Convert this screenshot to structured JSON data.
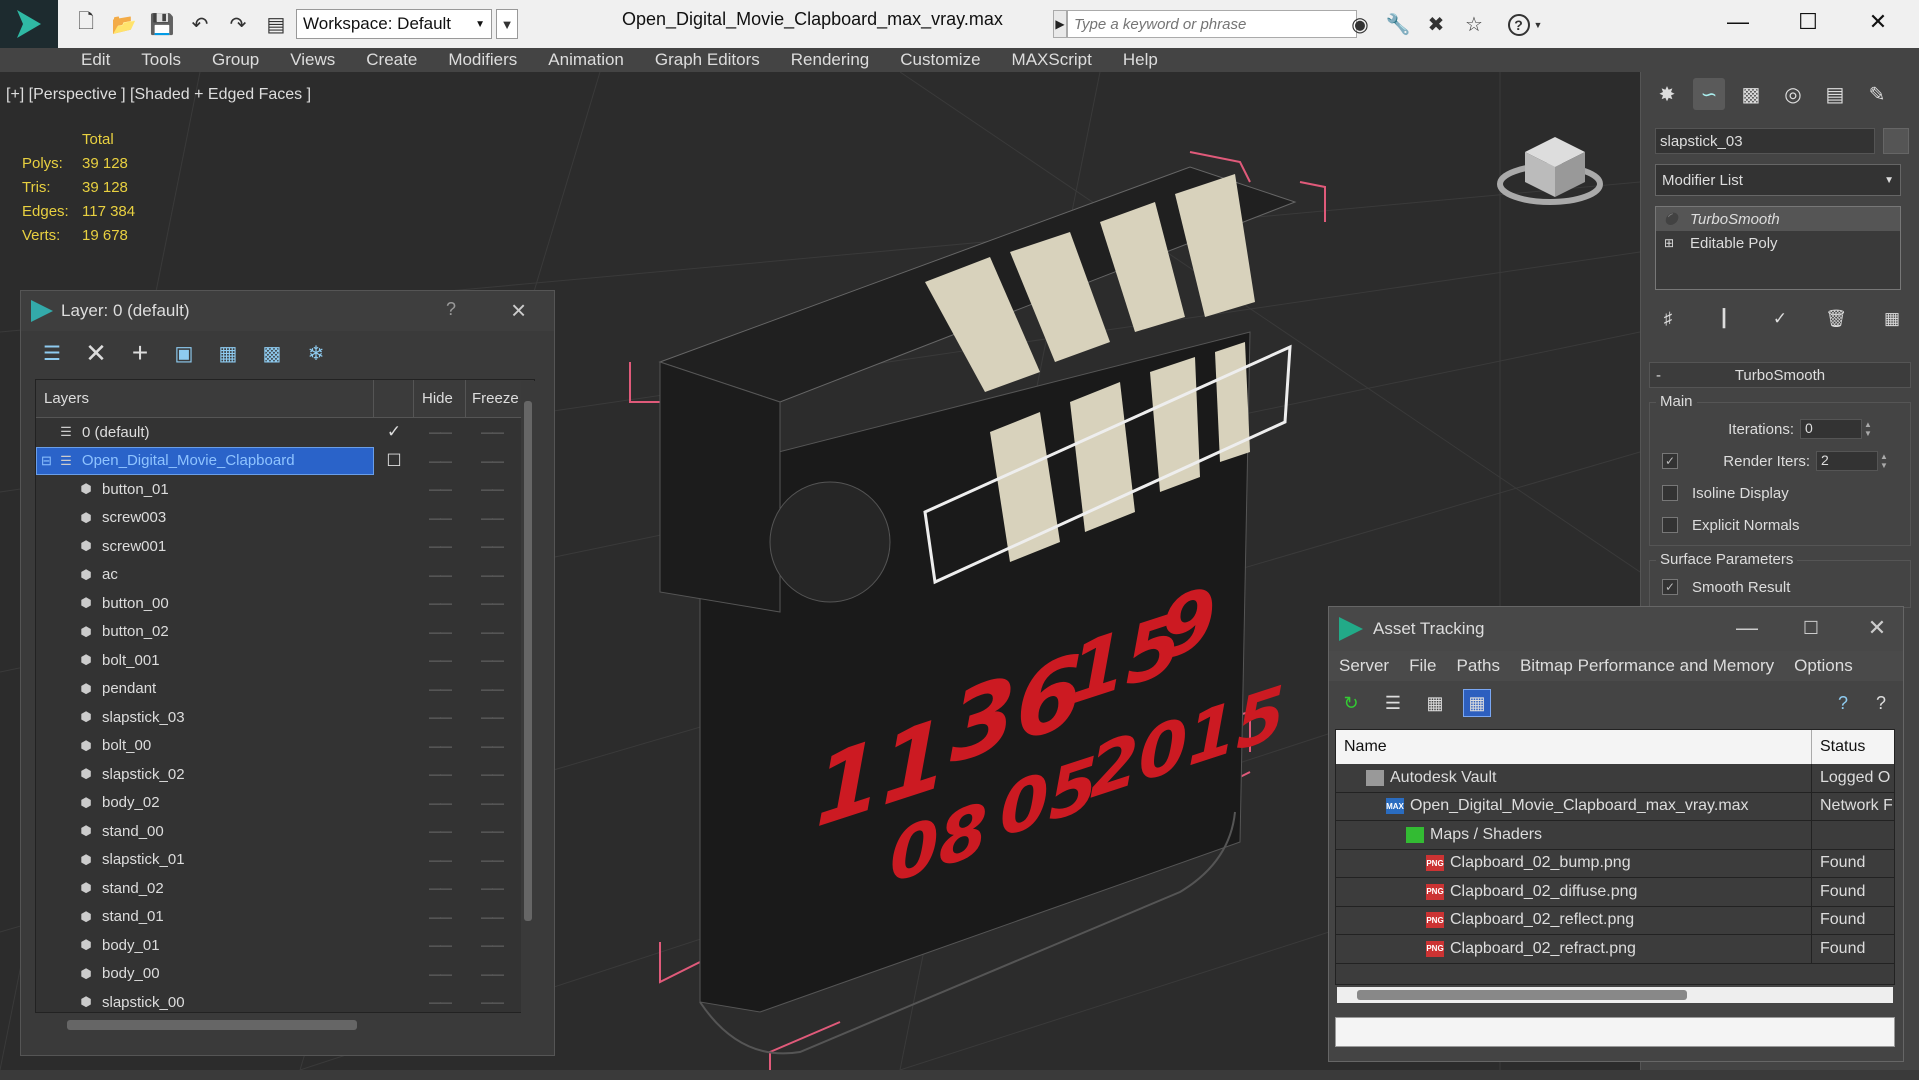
{
  "titlebar": {
    "doc_title": "Open_Digital_Movie_Clapboard_max_vray.max",
    "workspace": "Workspace: Default",
    "search_placeholder": "Type a keyword or phrase"
  },
  "menu": [
    "Edit",
    "Tools",
    "Group",
    "Views",
    "Create",
    "Modifiers",
    "Animation",
    "Graph Editors",
    "Rendering",
    "Customize",
    "MAXScript",
    "Help"
  ],
  "viewport": {
    "label": "[+] [Perspective ] [Shaded + Edged Faces ]",
    "stats_header": "Total",
    "stats": [
      {
        "k": "Polys:",
        "v": "39 128"
      },
      {
        "k": "Tris:",
        "v": "39 128"
      },
      {
        "k": "Edges:",
        "v": "117 384"
      },
      {
        "k": "Verts:",
        "v": "19 678"
      }
    ],
    "display_values": {
      "row1": [
        "11",
        "36",
        "15",
        "9"
      ],
      "row2": [
        "08",
        "05",
        "2015"
      ]
    }
  },
  "layer_panel": {
    "title": "Layer: 0 (default)",
    "help": "?",
    "col_layers": "Layers",
    "col_hide": "Hide",
    "col_freeze": "Freeze",
    "layers": [
      {
        "name": "0 (default)",
        "level": 0,
        "checked": true
      },
      {
        "name": "Open_Digital_Movie_Clapboard",
        "level": 0,
        "selected": true
      },
      {
        "name": "button_01",
        "level": 1
      },
      {
        "name": "screw003",
        "level": 1
      },
      {
        "name": "screw001",
        "level": 1
      },
      {
        "name": "ac",
        "level": 1
      },
      {
        "name": "button_00",
        "level": 1
      },
      {
        "name": "button_02",
        "level": 1
      },
      {
        "name": "bolt_001",
        "level": 1
      },
      {
        "name": "pendant",
        "level": 1
      },
      {
        "name": "slapstick_03",
        "level": 1
      },
      {
        "name": "bolt_00",
        "level": 1
      },
      {
        "name": "slapstick_02",
        "level": 1
      },
      {
        "name": "body_02",
        "level": 1
      },
      {
        "name": "stand_00",
        "level": 1
      },
      {
        "name": "slapstick_01",
        "level": 1
      },
      {
        "name": "stand_02",
        "level": 1
      },
      {
        "name": "stand_01",
        "level": 1
      },
      {
        "name": "body_01",
        "level": 1
      },
      {
        "name": "body_00",
        "level": 1
      },
      {
        "name": "slapstick_00",
        "level": 1
      }
    ]
  },
  "command_panel": {
    "object_name": "slapstick_03",
    "modifier_list": "Modifier List",
    "stack": [
      "TurboSmooth",
      "Editable Poly"
    ],
    "rollout_title": "TurboSmooth",
    "main_group": "Main",
    "iterations_label": "Iterations:",
    "iterations_value": "0",
    "render_iters_label": "Render Iters:",
    "render_iters_value": "2",
    "render_iters_checked": true,
    "isoline_label": "Isoline Display",
    "explicit_label": "Explicit Normals",
    "surface_group": "Surface Parameters",
    "smooth_result_label": "Smooth Result",
    "smooth_result_checked": true
  },
  "asset_tracking": {
    "title": "Asset Tracking",
    "menu": [
      "Server",
      "File",
      "Paths",
      "Bitmap Performance and Memory",
      "Options"
    ],
    "col_name": "Name",
    "col_status": "Status",
    "rows": [
      {
        "name": "Autodesk Vault",
        "status": "Logged O",
        "indent": 1,
        "icon": "vault"
      },
      {
        "name": "Open_Digital_Movie_Clapboard_max_vray.max",
        "status": "Network F",
        "indent": 2,
        "icon": "max"
      },
      {
        "name": "Maps / Shaders",
        "status": "",
        "indent": 3,
        "icon": "maps"
      },
      {
        "name": "Clapboard_02_bump.png",
        "status": "Found",
        "indent": 4,
        "icon": "png"
      },
      {
        "name": "Clapboard_02_diffuse.png",
        "status": "Found",
        "indent": 4,
        "icon": "png"
      },
      {
        "name": "Clapboard_02_reflect.png",
        "status": "Found",
        "indent": 4,
        "icon": "png"
      },
      {
        "name": "Clapboard_02_refract.png",
        "status": "Found",
        "indent": 4,
        "icon": "png"
      }
    ]
  },
  "icons": {
    "max_icon": "PNG",
    "max_file_icon": "MAX"
  },
  "colors": {
    "selection": "#2a63c9",
    "stats_yellow": "#e8d040",
    "led_red": "#cc1a22",
    "bbox_pink": "#e05a7a"
  }
}
